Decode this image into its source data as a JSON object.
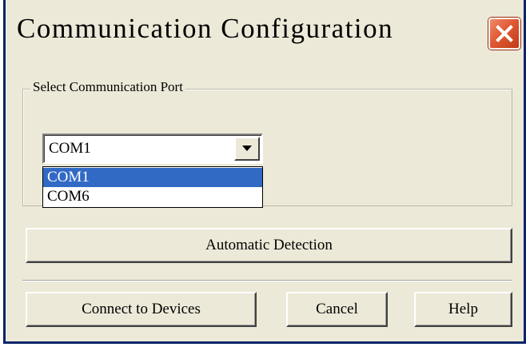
{
  "window": {
    "title": "Communication Configuration"
  },
  "icons": {
    "close": "close-icon",
    "dropdown_arrow": "chevron-down-icon"
  },
  "colors": {
    "close_button": "#e05a34",
    "selection": "#316ac5",
    "dialog_background": "#ece9d8"
  },
  "port_group": {
    "legend": "Select Communication Port",
    "selected_port": "COM1",
    "options": [
      "COM1",
      "COM6"
    ],
    "highlighted_option": "COM1"
  },
  "buttons": {
    "auto_detect": "Automatic Detection",
    "connect": "Connect to Devices",
    "cancel": "Cancel",
    "help": "Help"
  }
}
